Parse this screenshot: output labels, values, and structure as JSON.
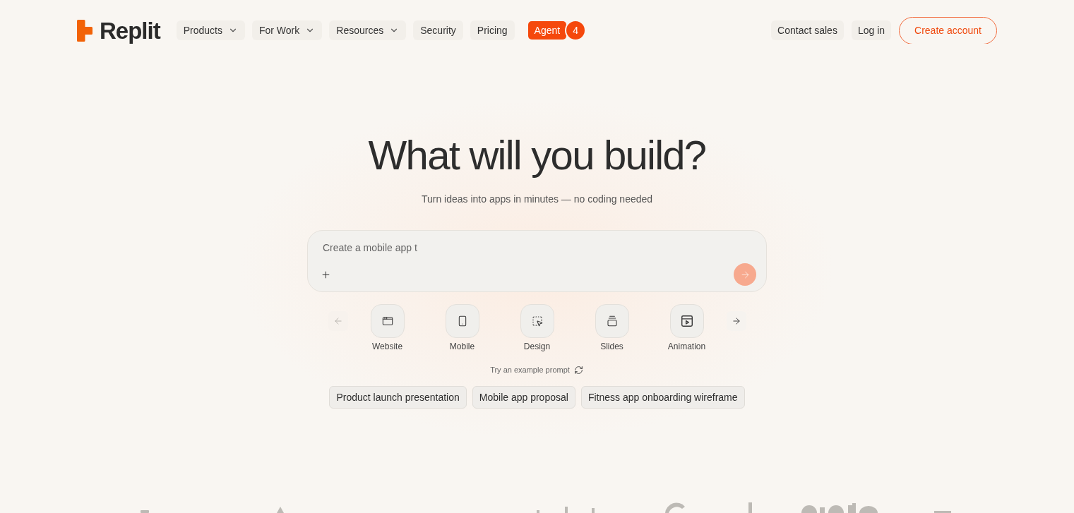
{
  "header": {
    "logo": {
      "wordmark": "Replit"
    },
    "nav": [
      {
        "kind": "dropdown",
        "label": "Products"
      },
      {
        "kind": "dropdown",
        "label": "For Work"
      },
      {
        "kind": "dropdown",
        "label": "Resources"
      },
      {
        "kind": "link",
        "label": "Security"
      },
      {
        "kind": "link",
        "label": "Pricing"
      },
      {
        "kind": "highlight",
        "label": "Agent",
        "badge": "4"
      }
    ],
    "actions": [
      {
        "kind": "link",
        "label": "Contact sales"
      },
      {
        "kind": "link",
        "label": "Log in"
      },
      {
        "kind": "outline",
        "label": "Create account"
      }
    ]
  },
  "hero": {
    "title": "What will you build?",
    "subtitle": "Turn ideas into apps in minutes — no coding needed"
  },
  "prompt": {
    "placeholder": "Create a mobile app t",
    "send_disabled": true
  },
  "categories": {
    "prev_disabled": true,
    "next_disabled": false,
    "items": [
      {
        "kind": "website",
        "label": "Website"
      },
      {
        "kind": "mobile",
        "label": "Mobile"
      },
      {
        "kind": "design",
        "label": "Design"
      },
      {
        "kind": "slides",
        "label": "Slides"
      },
      {
        "kind": "animation",
        "label": "Animation"
      }
    ]
  },
  "examples": {
    "label": "Try an example prompt",
    "chips": [
      "Product launch presentation",
      "Mobile app proposal",
      "Fitness app onboarding wireframe"
    ]
  }
}
